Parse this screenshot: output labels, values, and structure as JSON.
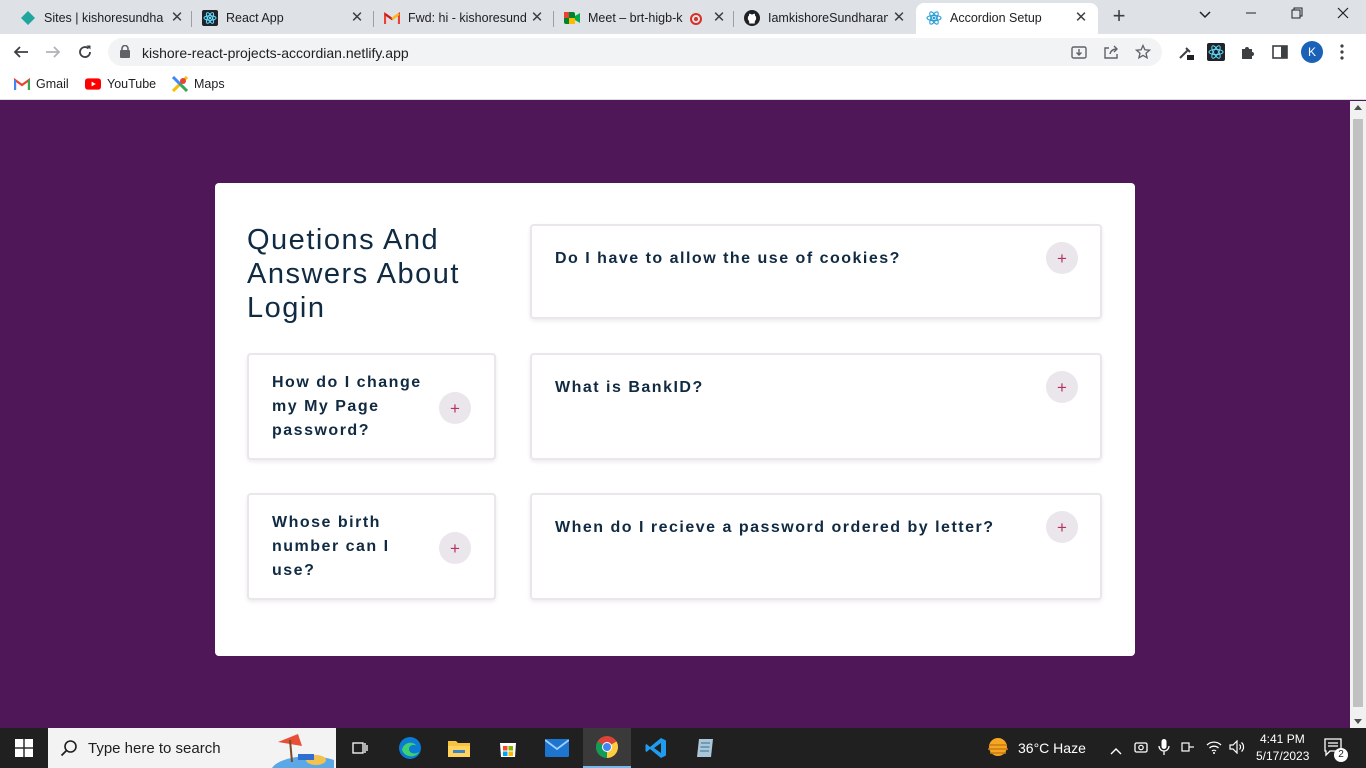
{
  "browser": {
    "tabs": [
      {
        "title": "Sites | kishoresundharam",
        "icon": "netlify-diamond-icon"
      },
      {
        "title": "React App",
        "icon": "react-icon"
      },
      {
        "title": "Fwd: hi - kishoresundharam",
        "icon": "gmail-icon"
      },
      {
        "title": "Meet – brt-higb-k",
        "icon": "google-meet-icon"
      },
      {
        "title": "IamkishoreSundharam",
        "icon": "github-icon"
      },
      {
        "title": "Accordion Setup",
        "icon": "react-icon"
      }
    ],
    "url": "kishore-react-projects-accordian.netlify.app",
    "profile_initial": "K",
    "bookmarks": [
      {
        "label": "Gmail",
        "icon": "gmail-icon"
      },
      {
        "label": "YouTube",
        "icon": "youtube-icon"
      },
      {
        "label": "Maps",
        "icon": "maps-icon"
      }
    ]
  },
  "page": {
    "background_color": "#4f1658",
    "title": "Quetions And Answers About Login",
    "questions": [
      {
        "text": "Do I have to allow the use of cookies?",
        "toggle": "+"
      },
      {
        "text": "How do I change my My Page password?",
        "toggle": "+"
      },
      {
        "text": "What is BankID?",
        "toggle": "+"
      },
      {
        "text": "Whose birth number can I use?",
        "toggle": "+"
      },
      {
        "text": "When do I recieve a password ordered by letter?",
        "toggle": "+"
      }
    ]
  },
  "taskbar": {
    "search_placeholder": "Type here to search",
    "weather": "36°C  Haze",
    "time": "4:41 PM",
    "date": "5/17/2023",
    "notification_count": "2"
  },
  "colors": {
    "heading": "#102a42",
    "plus_text": "#b4345c",
    "plus_bg": "#eae6eb"
  }
}
